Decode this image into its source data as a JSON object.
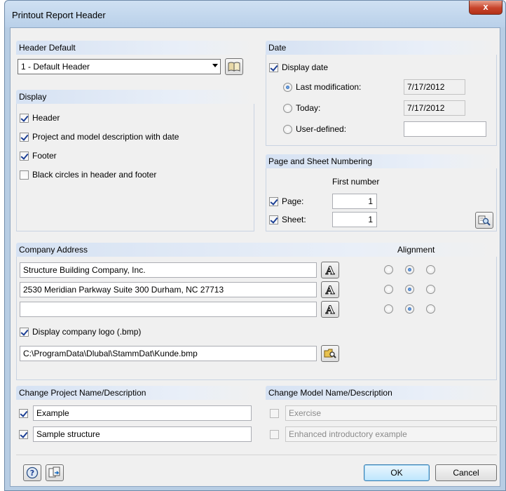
{
  "window": {
    "title": "Printout Report Header",
    "close_label": "x"
  },
  "header_default": {
    "title": "Header Default",
    "selected": "1 - Default Header"
  },
  "display": {
    "title": "Display",
    "items": [
      {
        "label": "Header",
        "checked": true
      },
      {
        "label": "Project and model description with date",
        "checked": true
      },
      {
        "label": "Footer",
        "checked": true
      },
      {
        "label": "Black circles in header and footer",
        "checked": false
      }
    ]
  },
  "date": {
    "title": "Date",
    "display_date_label": "Display date",
    "options": [
      {
        "label": "Last modification:",
        "value": "7/17/2012",
        "selected": true
      },
      {
        "label": "Today:",
        "value": "7/17/2012",
        "selected": false
      },
      {
        "label": "User-defined:",
        "value": "",
        "selected": false
      }
    ]
  },
  "numbering": {
    "title": "Page and Sheet Numbering",
    "first_number_label": "First number",
    "page_label": "Page:",
    "page_value": "1",
    "sheet_label": "Sheet:",
    "sheet_value": "1"
  },
  "company": {
    "title": "Company Address",
    "alignment_title": "Alignment",
    "lines": [
      "Structure Building Company, Inc.",
      "2530 Meridian Parkway Suite 300 Durham, NC 27713",
      ""
    ],
    "font_button_glyph": "A",
    "logo_label": "Display company logo (.bmp)",
    "logo_path": "C:\\ProgramData\\Dlubal\\StammDat\\Kunde.bmp"
  },
  "project": {
    "title": "Change Project Name/Description",
    "name": "Example",
    "description": "Sample structure"
  },
  "model": {
    "title": "Change Model Name/Description",
    "name": "Exercise",
    "description": "Enhanced introductory example"
  },
  "buttons": {
    "ok": "OK",
    "cancel": "Cancel",
    "help_glyph": "?"
  },
  "colors": {
    "accent": "#1c4e9c",
    "panel_header": "#d6e2f3",
    "dialog_bg": "#f0f0f0"
  }
}
